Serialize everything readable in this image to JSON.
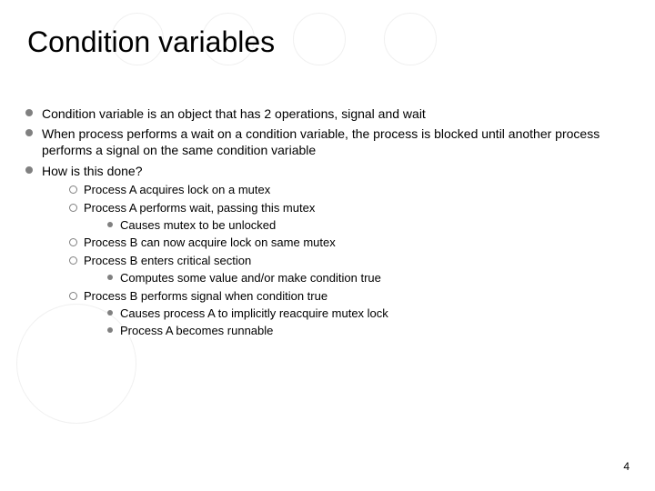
{
  "title": "Condition variables",
  "bullets": [
    {
      "text": "Condition variable is an object that has 2 operations, signal and wait"
    },
    {
      "text": "When process performs a wait on a condition variable, the process is blocked until another process performs a signal on the same condition variable"
    },
    {
      "text": "How is this done?",
      "children": [
        {
          "text": "Process A acquires lock on a mutex"
        },
        {
          "text": "Process A performs wait, passing this mutex",
          "children": [
            {
              "text": "Causes mutex to be unlocked"
            }
          ]
        },
        {
          "text": "Process B can now acquire lock on same mutex"
        },
        {
          "text": "Process B enters critical section",
          "children": [
            {
              "text": "Computes some value and/or make condition true"
            }
          ]
        },
        {
          "text": "Process B performs signal when condition true",
          "children": [
            {
              "text": "Causes process A to implicitly reacquire mutex lock"
            },
            {
              "text": "Process A becomes runnable"
            }
          ]
        }
      ]
    }
  ],
  "pageNumber": "4"
}
